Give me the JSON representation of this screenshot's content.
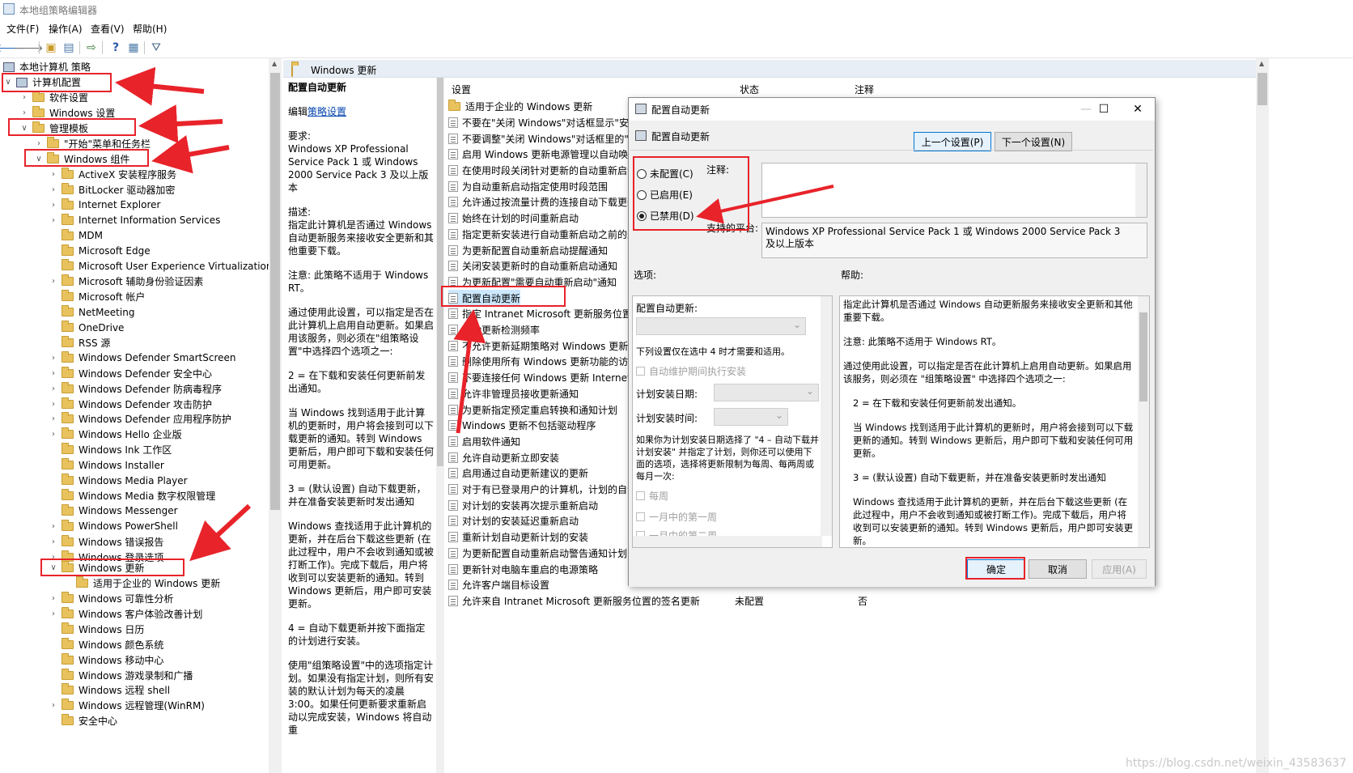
{
  "window": {
    "title": "本地组策略编辑器"
  },
  "menu": [
    "文件(F)",
    "操作(A)",
    "查看(V)",
    "帮助(H)"
  ],
  "toolbar": {
    "icons": [
      "back-icon",
      "forward-icon",
      "folder-up-icon",
      "show-tree-icon",
      "export-icon",
      "help-icon",
      "console-icon",
      "filter-icon"
    ]
  },
  "tree": {
    "root": "本地计算机 策略",
    "computer_config": "计算机配置",
    "software_settings": "软件设置",
    "windows_settings": "Windows 设置",
    "admin_templates": "管理模板",
    "start_menu": "\"开始\"菜单和任务栏",
    "windows_components": "Windows 组件",
    "components": [
      "ActiveX 安装程序服务",
      "BitLocker 驱动器加密",
      "Internet Explorer",
      "Internet Information Services",
      "MDM",
      "Microsoft Edge",
      "Microsoft User Experience Virtualization",
      "Microsoft 辅助身份验证因素",
      "Microsoft 帐户",
      "NetMeeting",
      "OneDrive",
      "RSS 源",
      "Windows Defender SmartScreen",
      "Windows Defender 安全中心",
      "Windows Defender 防病毒程序",
      "Windows Defender 攻击防护",
      "Windows Defender 应用程序防护",
      "Windows Hello 企业版",
      "Windows Ink 工作区",
      "Windows Installer",
      "Windows Media Player",
      "Windows Media 数字权限管理",
      "Windows Messenger",
      "Windows PowerShell",
      "Windows 错误报告",
      "Windows 登录选项"
    ],
    "windows_update": "Windows 更新",
    "enterprise_update": "适用于企业的 Windows 更新",
    "components_after": [
      "Windows 可靠性分析",
      "Windows 客户体验改善计划",
      "Windows 日历",
      "Windows 颜色系统",
      "Windows 移动中心",
      "Windows 游戏录制和广播",
      "Windows 远程 shell",
      "Windows 远程管理(WinRM)",
      "安全中心"
    ]
  },
  "pane": {
    "header": "Windows 更新",
    "desc_title": "配置自动更新",
    "edit_prefix": "编辑",
    "edit_link": "策略设置",
    "desc_paragraphs": [
      "要求:\nWindows XP Professional Service Pack 1 或 Windows 2000 Service Pack 3 及以上版本",
      "描述:\n指定此计算机是否通过 Windows 自动更新服务来接收安全更新和其他重要下载。",
      "注意: 此策略不适用于 Windows RT。",
      "通过使用此设置，可以指定是否在此计算机上启用自动更新。如果启用该服务，则必须在\"组策略设置\"中选择四个选项之一:",
      "2 = 在下载和安装任何更新前发出通知。",
      "当 Windows 找到适用于此计算机的更新时，用户将会接到可以下载更新的通知。转到 Windows 更新后，用户即可下载和安装任何可用更新。",
      "3 = (默认设置) 自动下载更新，并在准备安装更新时发出通知",
      "Windows 查找适用于此计算机的更新，并在后台下载这些更新 (在此过程中，用户不会收到通知或被打断工作)。完成下载后，用户将收到可以安装更新的通知。转到 Windows 更新后，用户即可安装更新。",
      "4 = 自动下载更新并按下面指定的计划进行安装。",
      "使用\"组策略设置\"中的选项指定计划。如果没有指定计划，则所有安装的默认计划为每天的凌晨 3:00。如果任何更新要求重新启动以完成安装，Windows 将自动重"
    ],
    "columns": [
      "设置",
      "状态",
      "注释"
    ],
    "settings": [
      "适用于企业的 Windows 更新",
      "不要在\"关闭 Windows\"对话框显示\"安装",
      "不要调整\"关闭 Windows\"对话框里的\"安",
      "启用 Windows 更新电源管理以自动唤醒",
      "在使用时段关闭针对更新的自动重新启动",
      "为自动重新启动指定使用时段范围",
      "允许通过按流量计费的连接自动下载更新",
      "始终在计划的时间重新启动",
      "指定更新安装进行自动重新启动之前的最",
      "为更新配置自动重新启动提醒通知",
      "关闭安装更新时的自动重新启动通知",
      "为更新配置\"需要自动重新启动\"通知",
      "配置自动更新",
      "指定 Intranet Microsoft 更新服务位置",
      "自动更新检测频率",
      "不允许更新延期策略对 Windows 更新执",
      "删除使用所有 Windows 更新功能的访问",
      "不要连接任何 Windows 更新 Internet 位",
      "允许非管理员接收更新通知",
      "为更新指定预定重启转换和通知计划",
      "Windows 更新不包括驱动程序",
      "启用软件通知",
      "允许自动更新立即安装",
      "启用通过自动更新建议的更新",
      "对于有已登录用户的计算机，计划的自动",
      "对计划的安装再次提示重新启动",
      "对计划的安装延迟重新启动",
      "重新计划自动更新计划的安装",
      "为更新配置自动重新启动警告通知计划",
      "更新针对电脑车重启的电源策略",
      "允许客户端目标设置",
      "允许来自 Intranet Microsoft 更新服务位置的签名更新"
    ],
    "last_state": "未配置",
    "last_comment": "否"
  },
  "dialog": {
    "title": "配置自动更新",
    "heading": "配置自动更新",
    "prev_btn": "上一个设置(P)",
    "next_btn": "下一个设置(N)",
    "radio_not_configured": "未配置(C)",
    "radio_enabled": "已启用(E)",
    "radio_disabled": "已禁用(D)",
    "selected": "disabled",
    "comment_label": "注释:",
    "platform_label": "支持的平台:",
    "platform_text": "Windows XP Professional Service Pack 1 或 Windows 2000 Service Pack 3 及以上版本",
    "options_label": "选项:",
    "help_label": "帮助:",
    "options": {
      "configure_label": "配置自动更新:",
      "note": "下列设置仅在选中 4 时才需要和适用。",
      "maint_check": "自动维护期间执行安装",
      "day_label": "计划安装日期:",
      "time_label": "计划安装时间:",
      "para": "如果你为计划安装日期选择了 \"4 – 自动下载并计划安装\" 并指定了计划，则你还可以使用下面的选项，选择将更新限制为每周、每两周或每月一次:",
      "weekly": "每周",
      "first_week": "一月中的第一周",
      "second_week": "一月中的第二周"
    },
    "help": [
      "指定此计算机是否通过 Windows 自动更新服务来接收安全更新和其他重要下载。",
      "注意: 此策略不适用于 Windows RT。",
      "通过使用此设置，可以指定是否在此计算机上启用自动更新。如果启用该服务，则必须在 \"组策略设置\" 中选择四个选项之一:",
      "2 = 在下载和安装任何更新前发出通知。",
      "当 Windows 找到适用于此计算机的更新时，用户将会接到可以下载更新的通知。转到 Windows 更新后，用户即可下载和安装任何可用更新。",
      "3 = (默认设置) 自动下载更新，并在准备安装更新时发出通知",
      "Windows 查找适用于此计算机的更新，并在后台下载这些更新 (在此过程中，用户不会收到通知或被打断工作)。完成下载后，用户将收到可以安装更新的通知。转到 Windows 更新后，用户即可安装更新。"
    ],
    "ok": "确定",
    "cancel": "取消",
    "apply": "应用(A)"
  },
  "annotations": {
    "highlight_color": "#e8232a"
  },
  "watermark": "https://blog.csdn.net/weixin_43583637"
}
